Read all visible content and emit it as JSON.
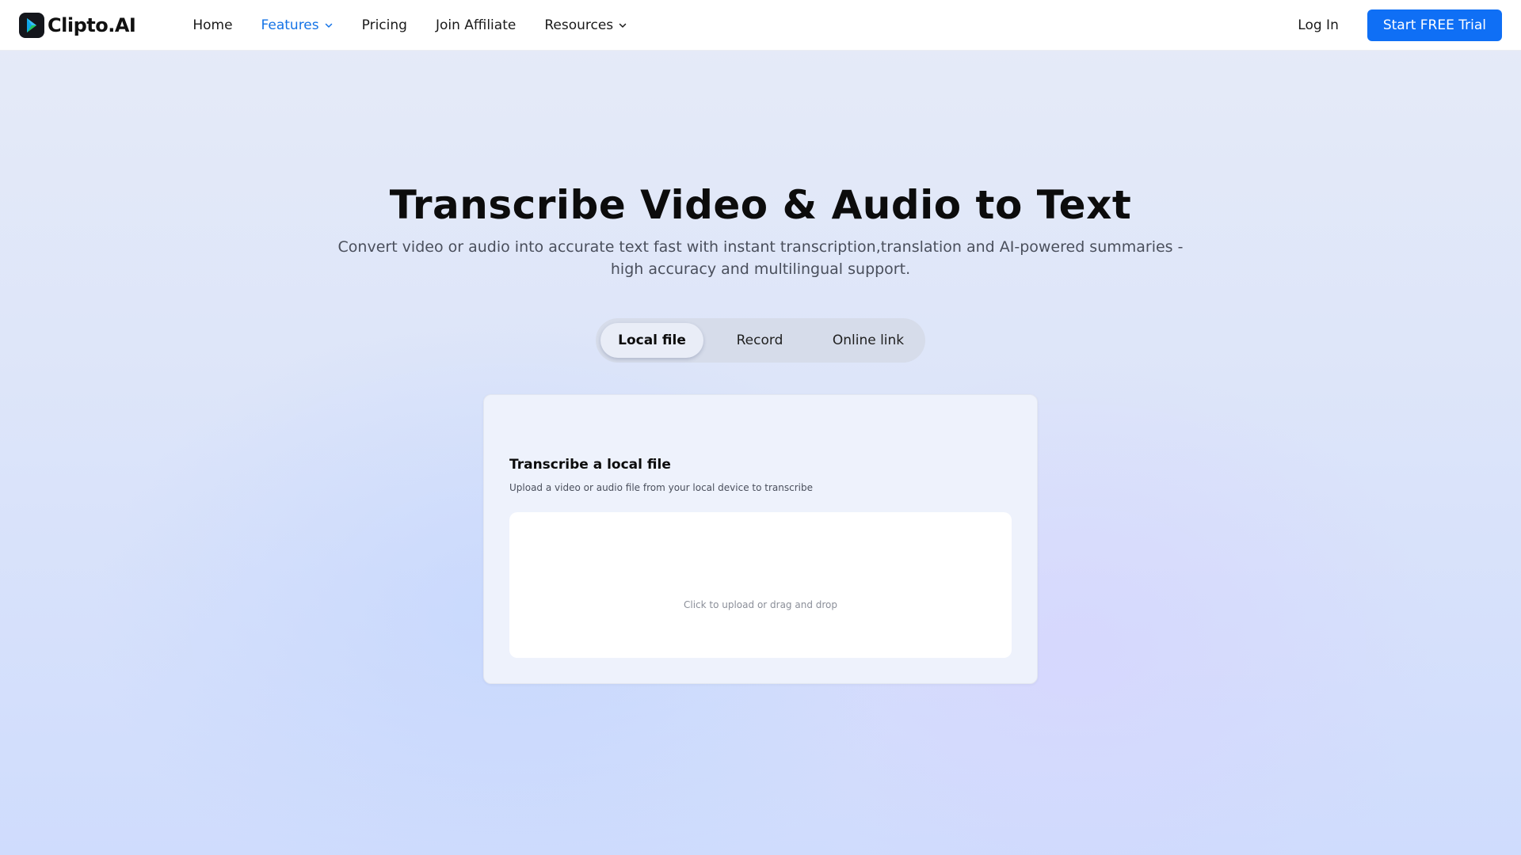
{
  "brand": {
    "name": "Clipto.AI",
    "logo_icon": "clipto-logo-icon"
  },
  "nav": {
    "items": [
      {
        "label": "Home"
      },
      {
        "label": "Features",
        "active": true,
        "has_dropdown": true
      },
      {
        "label": "Pricing"
      },
      {
        "label": "Join Affiliate"
      },
      {
        "label": "Resources",
        "has_dropdown": true
      }
    ],
    "login_label": "Log In",
    "cta_label": "Start FREE Trial"
  },
  "hero": {
    "title": "Transcribe Video & Audio to Text",
    "subtitle": "Convert video or audio into accurate text fast with instant transcription,translation and AI-powered summaries - high accuracy and multilingual support."
  },
  "tabs": {
    "items": [
      {
        "label": "Local file",
        "active": true
      },
      {
        "label": "Record"
      },
      {
        "label": "Online link"
      }
    ]
  },
  "upload_card": {
    "title": "Transcribe a local file",
    "description": "Upload a video or audio file from your local device to transcribe",
    "dropzone_text": "Click to upload or drag and drop"
  },
  "colors": {
    "accent": "#0f6ff5",
    "active_nav": "#1473e6",
    "background": "#dde5f9"
  }
}
